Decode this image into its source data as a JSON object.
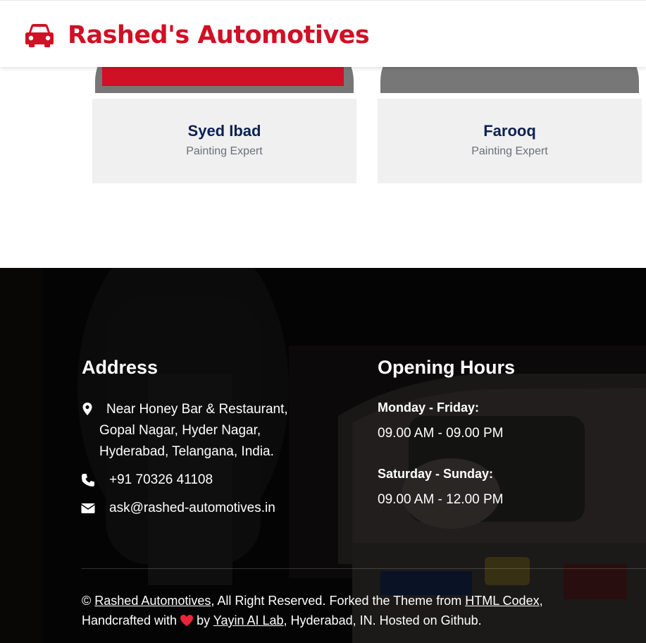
{
  "brand": {
    "name": "Rashed's Automotives",
    "icon": "car-icon",
    "color": "#D01025"
  },
  "team": [
    {
      "name": "Syed Ibad",
      "role": "Painting Expert"
    },
    {
      "name": "Farooq",
      "role": "Painting Expert"
    }
  ],
  "footer": {
    "address": {
      "title": "Address",
      "location_lines": [
        "Near Honey Bar & Restaurant,",
        "Gopal Nagar, Hyder Nagar,",
        "Hyderabad, Telangana, India."
      ],
      "phone": "+91 70326 41108",
      "email": "ask@rashed-automotives.in"
    },
    "hours": {
      "title": "Opening Hours",
      "weekday_label": "Monday - Friday:",
      "weekday_time": "09.00 AM - 09.00 PM",
      "weekend_label": "Saturday - Sunday:",
      "weekend_time": "09.00 AM - 12.00 PM"
    },
    "copyright": {
      "prefix": "©",
      "site_link": "Rashed Automotives",
      "text1": ", All Right Reserved. Forked the Theme from",
      "theme_link": "HTML Codex",
      "text2": ",",
      "text3": "Handcrafted with",
      "text4": "by",
      "lab_link": "Yayin AI Lab",
      "text5": ", Hyderabad, IN. Hosted on Github."
    }
  },
  "icons": [
    "car-icon",
    "map-marker-icon",
    "phone-icon",
    "envelope-icon",
    "heart-icon"
  ]
}
